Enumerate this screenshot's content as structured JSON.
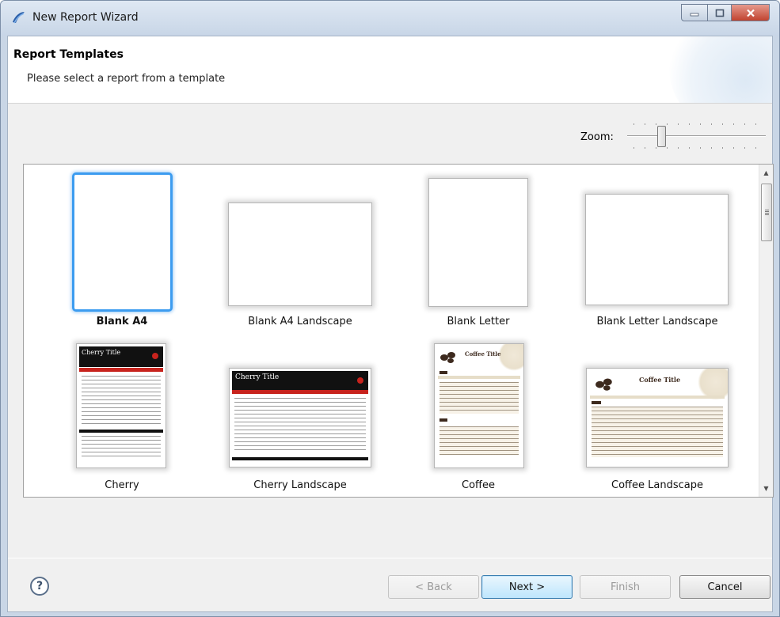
{
  "window": {
    "title": "New Report Wizard",
    "icon": "eclipse-birt-icon"
  },
  "header": {
    "title": "Report Templates",
    "description": "Please select a report from a template"
  },
  "zoom": {
    "label": "Zoom:",
    "level": 0.2
  },
  "templates": [
    {
      "label": "Blank A4",
      "selected": true,
      "preview": "blank"
    },
    {
      "label": "Blank A4 Landscape",
      "selected": false,
      "preview": "blank"
    },
    {
      "label": "Blank Letter",
      "selected": false,
      "preview": "blank"
    },
    {
      "label": "Blank Letter Landscape",
      "selected": false,
      "preview": "blank"
    },
    {
      "label": "Cherry",
      "selected": false,
      "preview": "cherry",
      "preview_title": "Cherry Title"
    },
    {
      "label": "Cherry Landscape",
      "selected": false,
      "preview": "cherry",
      "preview_title": "Cherry Title"
    },
    {
      "label": "Coffee",
      "selected": false,
      "preview": "coffee",
      "preview_title": "Coffee Title"
    },
    {
      "label": "Coffee Landscape",
      "selected": false,
      "preview": "coffee",
      "preview_title": "Coffee Title"
    }
  ],
  "footer": {
    "help_glyph": "?",
    "back_label": "< Back",
    "next_label": "Next >",
    "finish_label": "Finish",
    "cancel_label": "Cancel"
  },
  "colors": {
    "selection": "#3c9cf0",
    "cherry_red": "#c7231d",
    "coffee_brown": "#3d2a1e"
  }
}
